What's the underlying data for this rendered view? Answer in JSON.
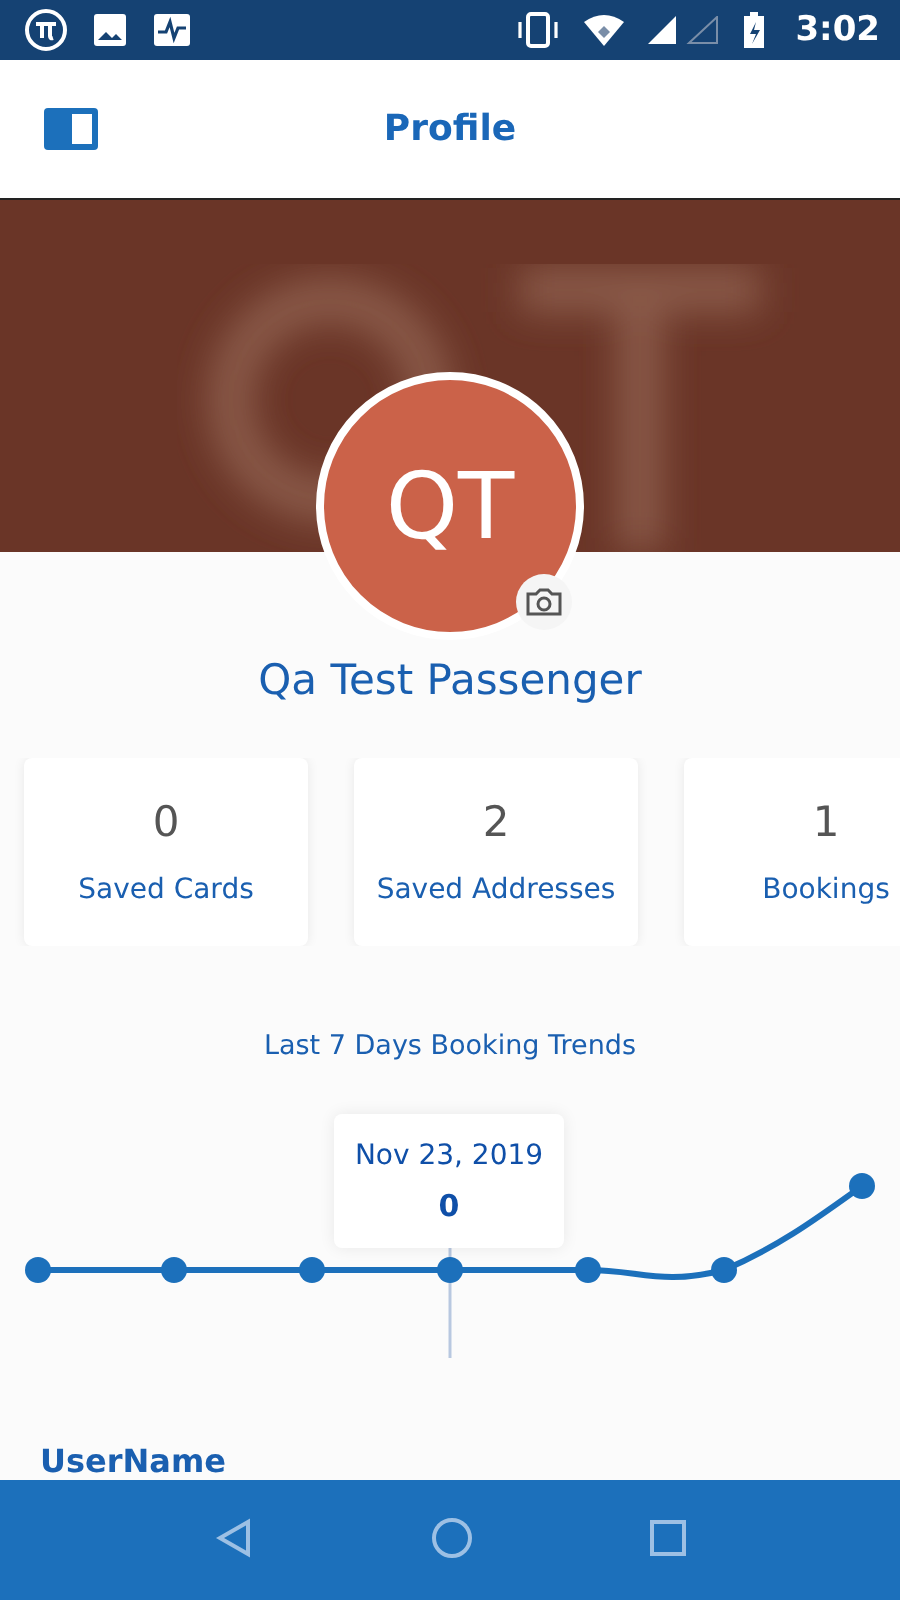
{
  "status_bar": {
    "time": "3:02"
  },
  "header": {
    "title": "Profile"
  },
  "profile": {
    "initials": "QT",
    "name": "Qa Test Passenger"
  },
  "stats": [
    {
      "value": "0",
      "label": "Saved Cards"
    },
    {
      "value": "2",
      "label": "Saved Addresses"
    },
    {
      "value": "1",
      "label": "Bookings"
    }
  ],
  "trend": {
    "title": "Last 7 Days Booking Trends",
    "tooltip": {
      "date": "Nov 23, 2019",
      "value": "0"
    }
  },
  "details": {
    "label": "UserName"
  }
}
